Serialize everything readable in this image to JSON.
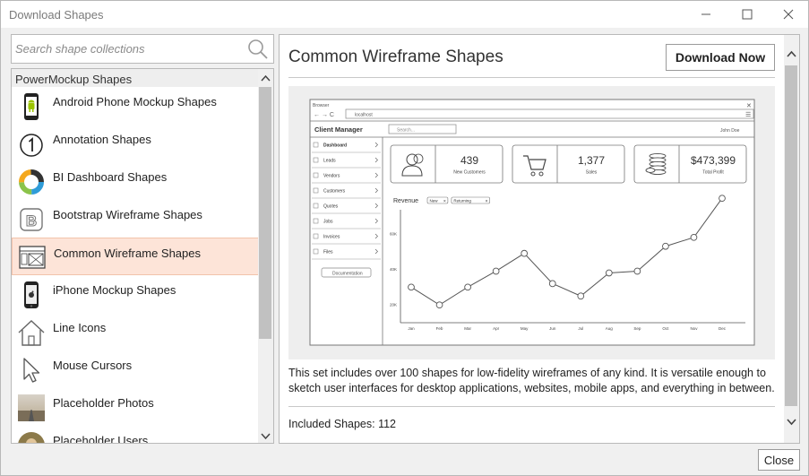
{
  "window": {
    "title": "Download Shapes",
    "minimize_icon": "minimize-icon",
    "maximize_icon": "maximize-icon",
    "close_icon": "close-icon"
  },
  "search": {
    "placeholder": "Search shape collections",
    "value": "",
    "icon": "search-icon"
  },
  "list": {
    "header": "PowerMockup Shapes",
    "selected_index": 4,
    "items": [
      {
        "label": "Android Phone Mockup Shapes",
        "icon": "android-phone-icon"
      },
      {
        "label": "Annotation Shapes",
        "icon": "annotation-icon"
      },
      {
        "label": "BI Dashboard Shapes",
        "icon": "donut-chart-icon"
      },
      {
        "label": "Bootstrap Wireframe Shapes",
        "icon": "bootstrap-icon"
      },
      {
        "label": "Common Wireframe Shapes",
        "icon": "wireframe-window-icon"
      },
      {
        "label": "iPhone Mockup Shapes",
        "icon": "iphone-icon"
      },
      {
        "label": "Line Icons",
        "icon": "house-line-icon"
      },
      {
        "label": "Mouse Cursors",
        "icon": "mouse-cursor-icon"
      },
      {
        "label": "Placeholder Photos",
        "icon": "photo-icon"
      },
      {
        "label": "Placeholder Users",
        "icon": "user-photo-icon"
      }
    ]
  },
  "detail": {
    "title": "Common Wireframe Shapes",
    "download_label": "Download Now",
    "description": "This set includes over 100 shapes for low-fidelity wireframes of any kind. It is versatile enough to sketch user interfaces for desktop applications, websites, mobile apps, and everything in between.",
    "included": "Included Shapes: 112"
  },
  "preview": {
    "browser_title": "Browser",
    "address": "localhost",
    "app_title": "Client Manager",
    "search_placeholder": "Search...",
    "user": "John Doe",
    "nav": [
      "Dashboard",
      "Leads",
      "Vendors",
      "Customers",
      "Quotes",
      "Jobs",
      "Invoices",
      "Files"
    ],
    "documentation": "Documentation",
    "stats": [
      {
        "value": "439",
        "label": "New Customers",
        "icon": "users-icon"
      },
      {
        "value": "1,377",
        "label": "Sales",
        "icon": "cart-icon"
      },
      {
        "value": "$473,399",
        "label": "Total Profit",
        "icon": "coins-icon"
      }
    ],
    "chart_title": "Revenue",
    "filters": [
      "New",
      "Returning"
    ]
  },
  "chart_data": {
    "type": "line",
    "title": "Revenue",
    "categories": [
      "Jan",
      "Feb",
      "Mar",
      "Apr",
      "May",
      "Jun",
      "Jul",
      "Aug",
      "Sep",
      "Oct",
      "Nov",
      "Dec"
    ],
    "yticks": [
      "20K",
      "40K",
      "60K"
    ],
    "ylim": [
      10,
      70
    ],
    "series": [
      {
        "values": [
          30,
          20,
          30,
          39,
          49,
          32,
          25,
          38,
          39,
          53,
          58,
          80
        ]
      }
    ]
  },
  "footer": {
    "close_label": "Close"
  }
}
